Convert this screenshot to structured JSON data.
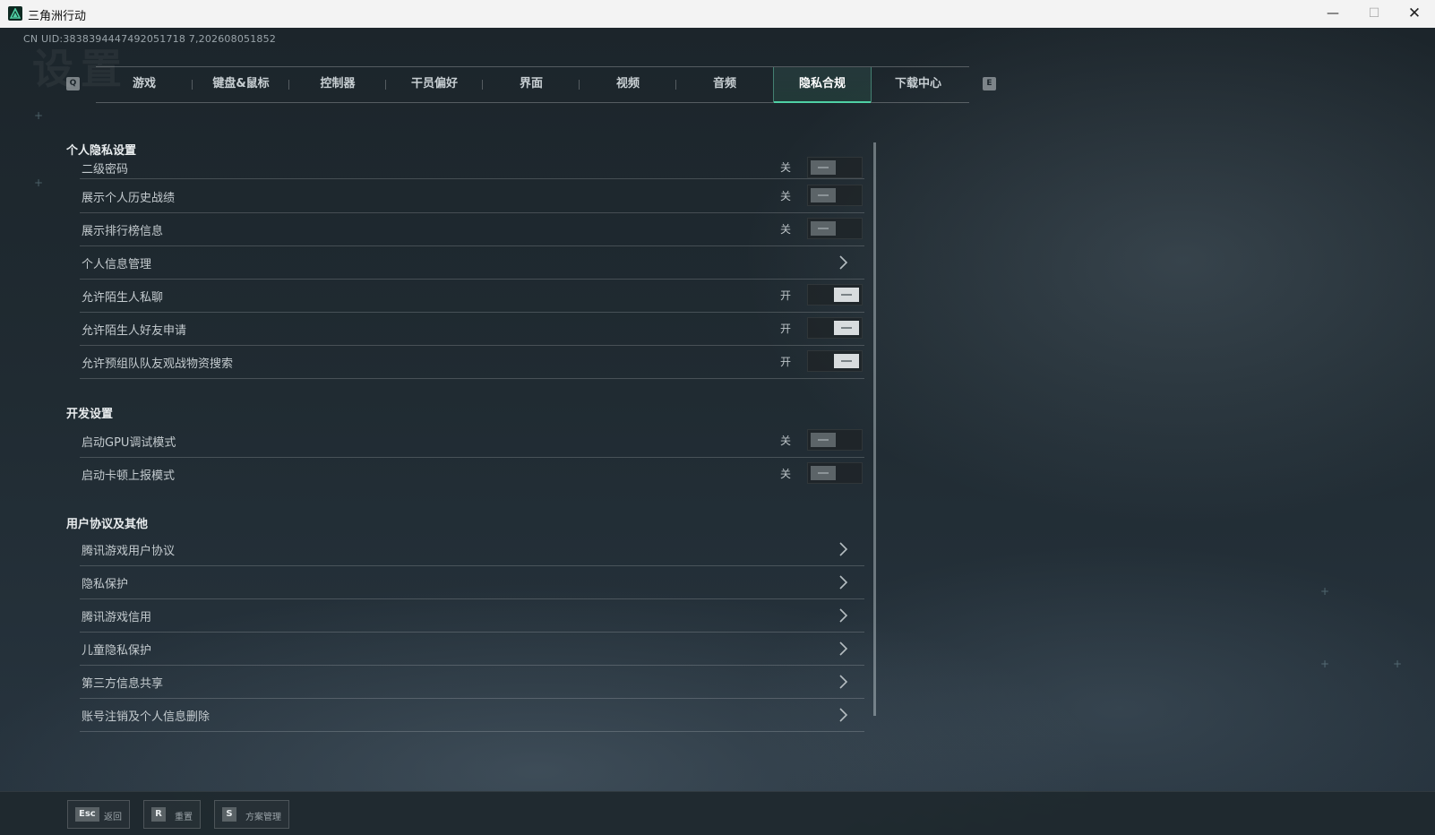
{
  "window": {
    "title": "三角洲行动",
    "minimize_glyph": "—",
    "maximize_glyph": "☐",
    "close_glyph": "✕"
  },
  "uid_text": "CN UID:3838394447492051718 7,202608051852",
  "background_title": "设置",
  "tabs": {
    "left_key": "Q",
    "right_key": "E",
    "items": [
      {
        "label": "游戏"
      },
      {
        "label": "键盘&鼠标"
      },
      {
        "label": "控制器"
      },
      {
        "label": "干员偏好"
      },
      {
        "label": "界面"
      },
      {
        "label": "视频"
      },
      {
        "label": "音频"
      },
      {
        "label": "隐私合规"
      },
      {
        "label": "下载中心"
      }
    ],
    "active": "隐私合规"
  },
  "sections": {
    "privacy": {
      "title": "个人隐私设置",
      "rows": [
        {
          "label": "二级密码",
          "state": "关",
          "type": "toggle",
          "on": false
        },
        {
          "label": "展示个人历史战绩",
          "state": "关",
          "type": "toggle",
          "on": false
        },
        {
          "label": "展示排行榜信息",
          "state": "关",
          "type": "toggle",
          "on": false
        },
        {
          "label": "个人信息管理",
          "type": "link"
        },
        {
          "label": "允许陌生人私聊",
          "state": "开",
          "type": "toggle",
          "on": true
        },
        {
          "label": "允许陌生人好友申请",
          "state": "开",
          "type": "toggle",
          "on": true
        },
        {
          "label": "允许预组队队友观战物资搜索",
          "state": "开",
          "type": "toggle",
          "on": true
        }
      ]
    },
    "dev": {
      "title": "开发设置",
      "rows": [
        {
          "label": "启动GPU调试模式",
          "state": "关",
          "type": "toggle",
          "on": false
        },
        {
          "label": "启动卡顿上报模式",
          "state": "关",
          "type": "toggle",
          "on": false
        }
      ]
    },
    "agreements": {
      "title": "用户协议及其他",
      "rows": [
        {
          "label": "腾讯游戏用户协议",
          "type": "link"
        },
        {
          "label": "隐私保护",
          "type": "link"
        },
        {
          "label": "腾讯游戏信用",
          "type": "link"
        },
        {
          "label": "儿童隐私保护",
          "type": "link"
        },
        {
          "label": "第三方信息共享",
          "type": "link"
        },
        {
          "label": "账号注销及个人信息删除",
          "type": "link"
        }
      ]
    }
  },
  "bottom": {
    "buttons": [
      {
        "key": "Esc",
        "label": "返回"
      },
      {
        "key": "R",
        "label": "重置"
      },
      {
        "key": "S",
        "label": "方案管理"
      }
    ]
  },
  "colors": {
    "accent": "#4fd1a5",
    "background": "#1c252b"
  }
}
